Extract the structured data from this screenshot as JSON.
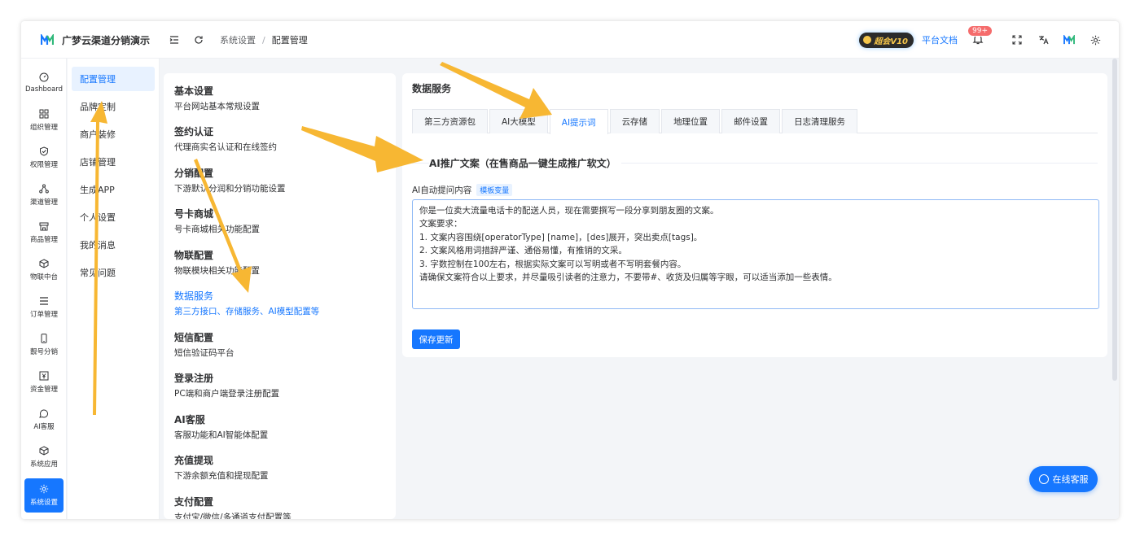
{
  "app": {
    "title": "广梦云渠道分销演示"
  },
  "breadcrumb": {
    "items": [
      "系统设置",
      "配置管理"
    ],
    "sep": "/"
  },
  "header": {
    "vip_label": "超会V10",
    "doc_link": "平台文档",
    "notify_count": "99+"
  },
  "rail": {
    "items": [
      {
        "label": "Dashboard",
        "icon": "dashboard-icon"
      },
      {
        "label": "组织管理",
        "icon": "grid-icon"
      },
      {
        "label": "权限管理",
        "icon": "shield-icon"
      },
      {
        "label": "渠道管理",
        "icon": "network-icon"
      },
      {
        "label": "商品管理",
        "icon": "store-icon"
      },
      {
        "label": "物联中台",
        "icon": "cube-icon"
      },
      {
        "label": "订单管理",
        "icon": "list-icon"
      },
      {
        "label": "靓号分销",
        "icon": "phone-icon"
      },
      {
        "label": "资金管理",
        "icon": "money-icon"
      },
      {
        "label": "AI客服",
        "icon": "chat-icon"
      },
      {
        "label": "系统应用",
        "icon": "app-icon"
      },
      {
        "label": "系统设置",
        "icon": "gear-icon"
      }
    ]
  },
  "submenu": {
    "items": [
      "配置管理",
      "品牌定制",
      "商户装修",
      "店铺管理",
      "生成APP",
      "个人设置",
      "我的消息",
      "常见问题"
    ]
  },
  "settings": {
    "groups": [
      {
        "title": "基本设置",
        "desc": "平台网站基本常规设置"
      },
      {
        "title": "签约认证",
        "desc": "代理商实名认证和在线签约"
      },
      {
        "title": "分销配置",
        "desc": "下游默认分润和分销功能设置"
      },
      {
        "title": "号卡商城",
        "desc": "号卡商城相关功能配置"
      },
      {
        "title": "物联配置",
        "desc": "物联模块相关功能配置"
      },
      {
        "title": "数据服务",
        "desc": "第三方接口、存储服务、AI模型配置等"
      },
      {
        "title": "短信配置",
        "desc": "短信验证码平台"
      },
      {
        "title": "登录注册",
        "desc": "PC端和商户端登录注册配置"
      },
      {
        "title": "AI客服",
        "desc": "客服功能和AI智能体配置"
      },
      {
        "title": "充值提现",
        "desc": "下游余额充值和提现配置"
      },
      {
        "title": "支付配置",
        "desc": "支付宝/微信/多通道支付配置等"
      }
    ]
  },
  "main": {
    "title": "数据服务",
    "tabs": [
      "第三方资源包",
      "AI大模型",
      "AI提示词",
      "云存储",
      "地理位置",
      "邮件设置",
      "日志清理服务"
    ],
    "section_title": "AI推广文案（在售商品一键生成推广软文）",
    "field_label": "AI自动提问内容",
    "tag": "模板变量",
    "prompt": "你是一位卖大流量电话卡的配送人员，现在需要撰写一段分享到朋友圈的文案。\n文案要求：\n1. 文案内容围绕[operatorType] [name]，[des]展开，突出卖点[tags]。\n2. 文案风格用词措辞严谨、通俗易懂，有推销的文采。\n3. 字数控制在100左右，根据实际文案可以写明或者不写明套餐内容。\n请确保文案符合以上要求，并尽量吸引读者的注意力，不要带#、收货及归属等字眼，可以适当添加一些表情。",
    "save_label": "保存更新"
  },
  "service": {
    "label": "在线客服"
  },
  "colors": {
    "accent": "#1677ff",
    "arrow": "#f7b733",
    "badge": "#f56c6c"
  }
}
